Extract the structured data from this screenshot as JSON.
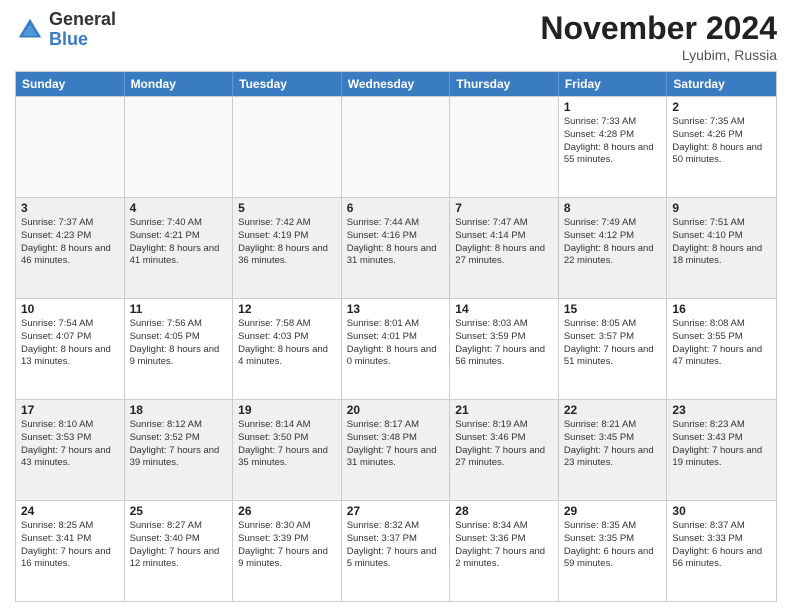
{
  "logo": {
    "general": "General",
    "blue": "Blue"
  },
  "title": "November 2024",
  "location": "Lyubim, Russia",
  "days_of_week": [
    "Sunday",
    "Monday",
    "Tuesday",
    "Wednesday",
    "Thursday",
    "Friday",
    "Saturday"
  ],
  "weeks": [
    [
      {
        "day": "",
        "detail": ""
      },
      {
        "day": "",
        "detail": ""
      },
      {
        "day": "",
        "detail": ""
      },
      {
        "day": "",
        "detail": ""
      },
      {
        "day": "",
        "detail": ""
      },
      {
        "day": "1",
        "detail": "Sunrise: 7:33 AM\nSunset: 4:28 PM\nDaylight: 8 hours\nand 55 minutes."
      },
      {
        "day": "2",
        "detail": "Sunrise: 7:35 AM\nSunset: 4:26 PM\nDaylight: 8 hours\nand 50 minutes."
      }
    ],
    [
      {
        "day": "3",
        "detail": "Sunrise: 7:37 AM\nSunset: 4:23 PM\nDaylight: 8 hours\nand 46 minutes."
      },
      {
        "day": "4",
        "detail": "Sunrise: 7:40 AM\nSunset: 4:21 PM\nDaylight: 8 hours\nand 41 minutes."
      },
      {
        "day": "5",
        "detail": "Sunrise: 7:42 AM\nSunset: 4:19 PM\nDaylight: 8 hours\nand 36 minutes."
      },
      {
        "day": "6",
        "detail": "Sunrise: 7:44 AM\nSunset: 4:16 PM\nDaylight: 8 hours\nand 31 minutes."
      },
      {
        "day": "7",
        "detail": "Sunrise: 7:47 AM\nSunset: 4:14 PM\nDaylight: 8 hours\nand 27 minutes."
      },
      {
        "day": "8",
        "detail": "Sunrise: 7:49 AM\nSunset: 4:12 PM\nDaylight: 8 hours\nand 22 minutes."
      },
      {
        "day": "9",
        "detail": "Sunrise: 7:51 AM\nSunset: 4:10 PM\nDaylight: 8 hours\nand 18 minutes."
      }
    ],
    [
      {
        "day": "10",
        "detail": "Sunrise: 7:54 AM\nSunset: 4:07 PM\nDaylight: 8 hours\nand 13 minutes."
      },
      {
        "day": "11",
        "detail": "Sunrise: 7:56 AM\nSunset: 4:05 PM\nDaylight: 8 hours\nand 9 minutes."
      },
      {
        "day": "12",
        "detail": "Sunrise: 7:58 AM\nSunset: 4:03 PM\nDaylight: 8 hours\nand 4 minutes."
      },
      {
        "day": "13",
        "detail": "Sunrise: 8:01 AM\nSunset: 4:01 PM\nDaylight: 8 hours\nand 0 minutes."
      },
      {
        "day": "14",
        "detail": "Sunrise: 8:03 AM\nSunset: 3:59 PM\nDaylight: 7 hours\nand 56 minutes."
      },
      {
        "day": "15",
        "detail": "Sunrise: 8:05 AM\nSunset: 3:57 PM\nDaylight: 7 hours\nand 51 minutes."
      },
      {
        "day": "16",
        "detail": "Sunrise: 8:08 AM\nSunset: 3:55 PM\nDaylight: 7 hours\nand 47 minutes."
      }
    ],
    [
      {
        "day": "17",
        "detail": "Sunrise: 8:10 AM\nSunset: 3:53 PM\nDaylight: 7 hours\nand 43 minutes."
      },
      {
        "day": "18",
        "detail": "Sunrise: 8:12 AM\nSunset: 3:52 PM\nDaylight: 7 hours\nand 39 minutes."
      },
      {
        "day": "19",
        "detail": "Sunrise: 8:14 AM\nSunset: 3:50 PM\nDaylight: 7 hours\nand 35 minutes."
      },
      {
        "day": "20",
        "detail": "Sunrise: 8:17 AM\nSunset: 3:48 PM\nDaylight: 7 hours\nand 31 minutes."
      },
      {
        "day": "21",
        "detail": "Sunrise: 8:19 AM\nSunset: 3:46 PM\nDaylight: 7 hours\nand 27 minutes."
      },
      {
        "day": "22",
        "detail": "Sunrise: 8:21 AM\nSunset: 3:45 PM\nDaylight: 7 hours\nand 23 minutes."
      },
      {
        "day": "23",
        "detail": "Sunrise: 8:23 AM\nSunset: 3:43 PM\nDaylight: 7 hours\nand 19 minutes."
      }
    ],
    [
      {
        "day": "24",
        "detail": "Sunrise: 8:25 AM\nSunset: 3:41 PM\nDaylight: 7 hours\nand 16 minutes."
      },
      {
        "day": "25",
        "detail": "Sunrise: 8:27 AM\nSunset: 3:40 PM\nDaylight: 7 hours\nand 12 minutes."
      },
      {
        "day": "26",
        "detail": "Sunrise: 8:30 AM\nSunset: 3:39 PM\nDaylight: 7 hours\nand 9 minutes."
      },
      {
        "day": "27",
        "detail": "Sunrise: 8:32 AM\nSunset: 3:37 PM\nDaylight: 7 hours\nand 5 minutes."
      },
      {
        "day": "28",
        "detail": "Sunrise: 8:34 AM\nSunset: 3:36 PM\nDaylight: 7 hours\nand 2 minutes."
      },
      {
        "day": "29",
        "detail": "Sunrise: 8:35 AM\nSunset: 3:35 PM\nDaylight: 6 hours\nand 59 minutes."
      },
      {
        "day": "30",
        "detail": "Sunrise: 8:37 AM\nSunset: 3:33 PM\nDaylight: 6 hours\nand 56 minutes."
      }
    ]
  ]
}
